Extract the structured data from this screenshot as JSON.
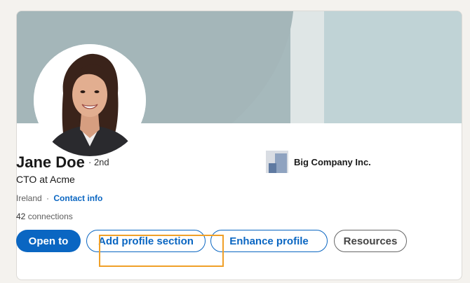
{
  "profile": {
    "name": "Jane Doe",
    "degree": "· 2nd",
    "headline": "CTO at Acme",
    "location": "Ireland",
    "location_separator": "·",
    "contact_info": "Contact info",
    "connections_count": "42",
    "connections_label": "connections"
  },
  "company": {
    "name": "Big Company Inc.",
    "icon": "company-logo"
  },
  "actions": {
    "open_to": "Open to",
    "add_profile_section": "Add profile section",
    "enhance_profile": "Enhance profile",
    "resources": "Resources"
  },
  "colors": {
    "primary": "#0a66c2",
    "highlight": "#f0a028",
    "banner": "#a6b9bc"
  }
}
